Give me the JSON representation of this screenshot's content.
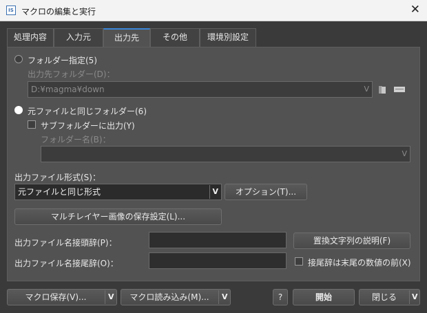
{
  "window": {
    "title": "マクロの編集と実行",
    "app_icon_text": "IS"
  },
  "tabs": [
    {
      "label": "処理内容",
      "active": false
    },
    {
      "label": "入力元",
      "active": false
    },
    {
      "label": "出力先",
      "active": true
    },
    {
      "label": "その他",
      "active": false
    },
    {
      "label": "環境別設定",
      "active": false
    }
  ],
  "output": {
    "folder_radio_label": "フォルダー指定(5)",
    "folder_label": "出力先フォルダー(D)：",
    "folder_value": "D:¥magma¥down",
    "same_folder_radio_label": "元ファイルと同じフォルダー(6)",
    "subfolder_check_label": "サブフォルダーに出力(Y)",
    "subfolder_name_label": "フォルダー名(B)：",
    "subfolder_name_value": "",
    "format_label": "出力ファイル形式(S)：",
    "format_value": "元ファイルと同じ形式",
    "options_button": "オプション(T)...",
    "multilayer_button": "マルチレイヤー画像の保存設定(L)...",
    "prefix_label": "出力ファイル名接頭辞(P)：",
    "prefix_value": "",
    "replace_help_button": "置換文字列の説明(F)",
    "suffix_label": "出力ファイル名接尾辞(O)：",
    "suffix_value": "",
    "suffix_before_num_label": "接尾辞は末尾の数値の前(X)"
  },
  "footer": {
    "save_macro": "マクロ保存(V)...",
    "load_macro": "マクロ読み込み(M)...",
    "help": "?",
    "start": "開始",
    "close": "閉じる"
  },
  "glyphs": {
    "chevron": "V",
    "close": "✕"
  },
  "colors": {
    "accent": "#3a86d8",
    "panel": "#525252",
    "window_bg": "#3a3a3a"
  }
}
